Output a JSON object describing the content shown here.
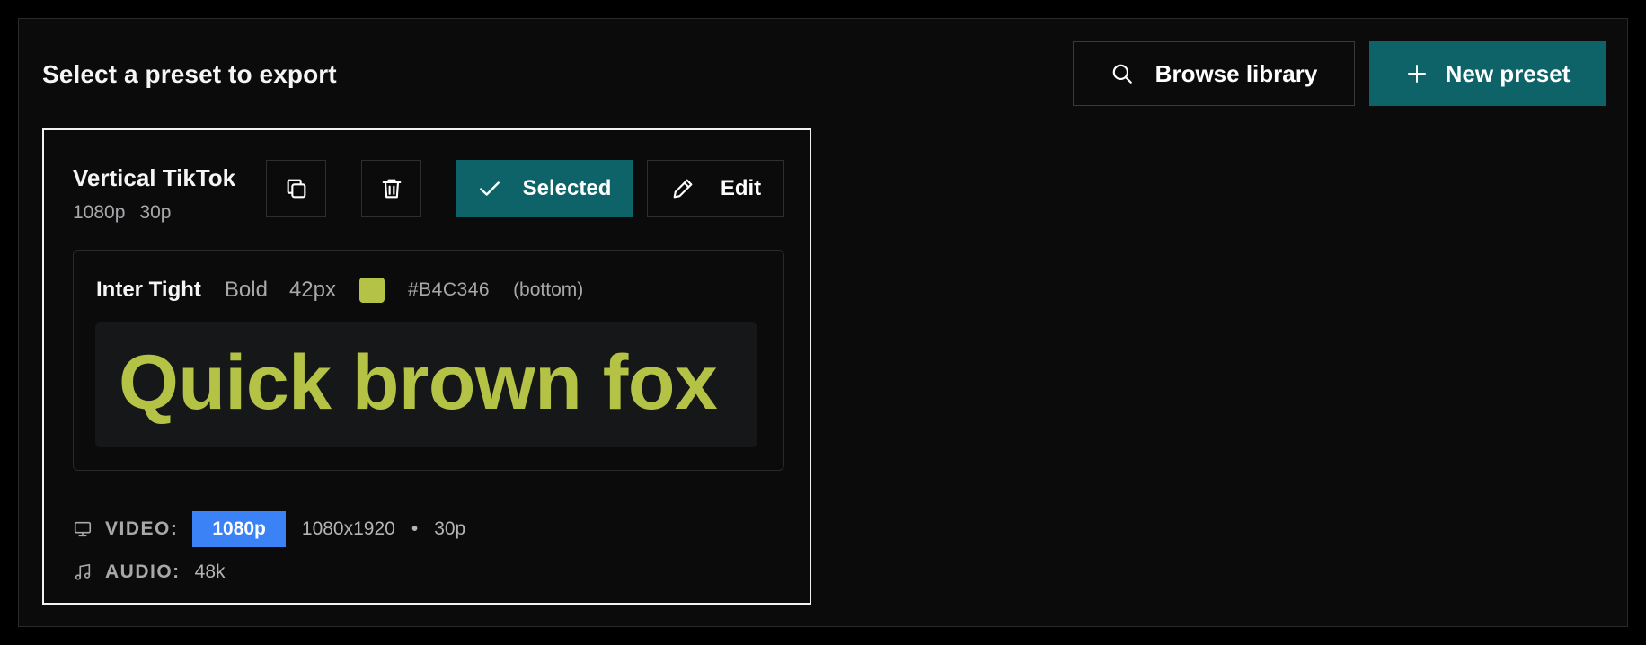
{
  "panel": {
    "title": "Select a preset to export"
  },
  "toolbar": {
    "browse_label": "Browse library",
    "browse_icon": "search-icon",
    "new_label": "New preset",
    "new_icon": "plus-icon"
  },
  "preset": {
    "name": "Vertical TikTok",
    "meta_resolution": "1080p",
    "meta_fps": "30p",
    "actions": {
      "duplicate_icon": "copy-icon",
      "delete_icon": "trash-icon",
      "selected_label": "Selected",
      "edit_label": "Edit"
    },
    "caption_style": {
      "font": "Inter Tight",
      "weight": "Bold",
      "size": "42px",
      "color": "#B4C346",
      "color_label": "#B4C346",
      "position": "(bottom)",
      "preview_text": "Quick brown fox"
    },
    "video": {
      "label": "VIDEO:",
      "badge": "1080p",
      "dimensions": "1080x1920",
      "separator": "•",
      "fps": "30p"
    },
    "audio": {
      "label": "AUDIO:",
      "bitrate": "48k"
    }
  },
  "colors": {
    "accent_teal": "#0e6369",
    "badge_blue": "#3b82f6",
    "caption_color": "#B4C346"
  }
}
